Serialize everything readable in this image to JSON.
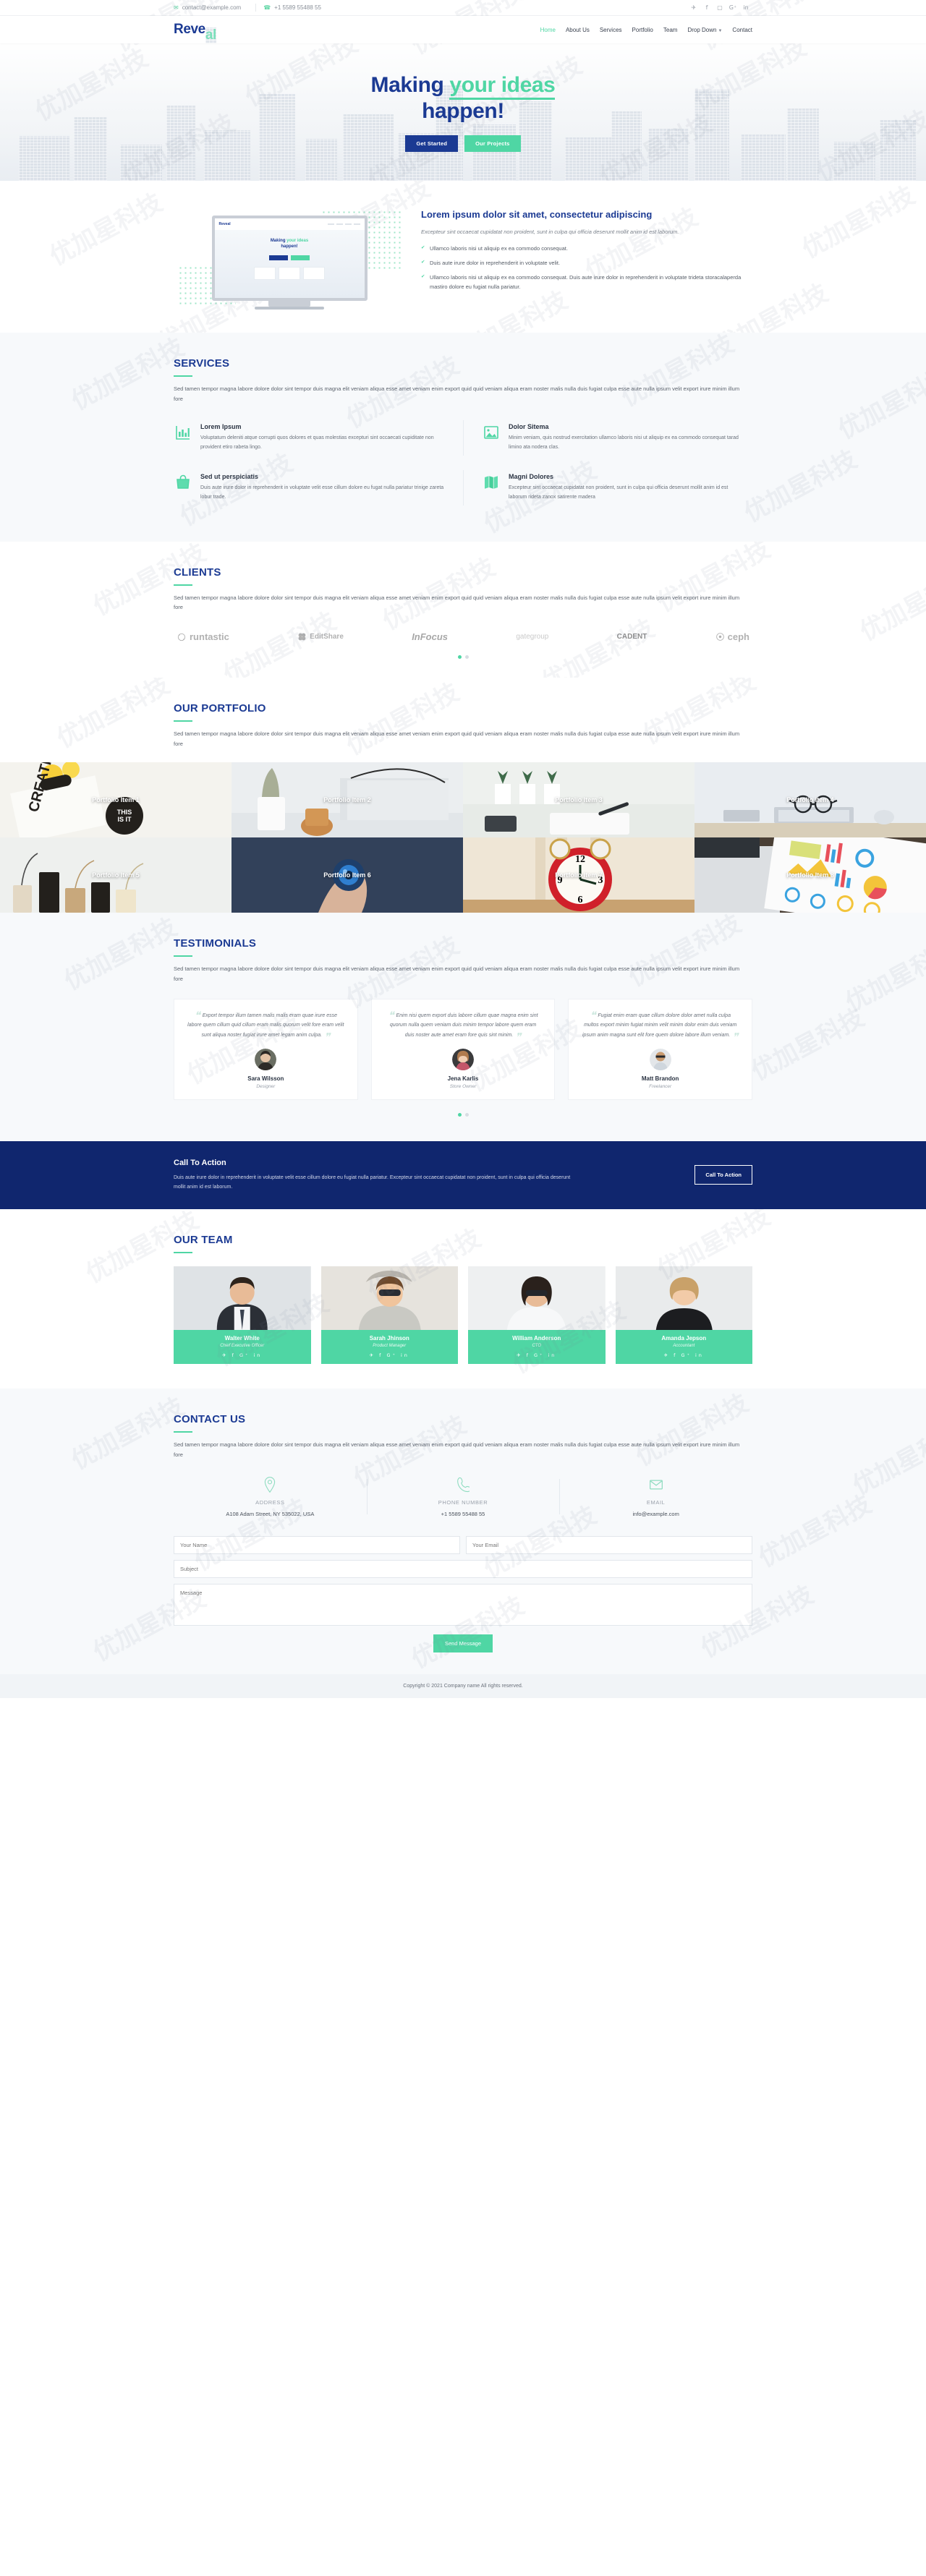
{
  "topbar": {
    "email": "contact@example.com",
    "phone": "+1 5589 55488 55",
    "email_icon": "envelope-icon",
    "phone_icon": "phone-icon",
    "social": [
      {
        "name": "twitter",
        "glyph": "✈"
      },
      {
        "name": "facebook",
        "glyph": "f"
      },
      {
        "name": "instagram",
        "glyph": "▢"
      },
      {
        "name": "google-plus",
        "glyph": "G⁺"
      },
      {
        "name": "linkedin",
        "glyph": "in"
      }
    ]
  },
  "nav": {
    "logo_a": "Reve",
    "logo_b": "al",
    "items": [
      {
        "label": "Home",
        "active": true
      },
      {
        "label": "About Us",
        "active": false
      },
      {
        "label": "Services",
        "active": false
      },
      {
        "label": "Portfolio",
        "active": false
      },
      {
        "label": "Team",
        "active": false
      },
      {
        "label": "Drop Down",
        "active": false,
        "caret": true
      },
      {
        "label": "Contact",
        "active": false
      }
    ]
  },
  "hero": {
    "title_part1": "Making ",
    "title_highlight": "your ideas",
    "title_part2": "happen!",
    "btn_primary": "Get Started",
    "btn_secondary": "Our Projects"
  },
  "about": {
    "heading": "Lorem ipsum dolor sit amet, consectetur adipiscing",
    "lead": "Excepteur sint occaecat cupidatat non proident, sunt in culpa qui officia deserunt mollit anim id est laborum.",
    "bullets": [
      "Ullamco laboris nisi ut aliquip ex ea commodo consequat.",
      "Duis aute irure dolor in reprehenderit in voluptate velit.",
      "Ullamco laboris nisi ut aliquip ex ea commodo consequat. Duis aute irure dolor in reprehenderit in voluptate trideta storacalaperda mastiro dolore eu fugiat nulla pariatur."
    ],
    "monitor": {
      "mini_logo": "Reveal",
      "mini_title_1": "Making ",
      "mini_title_hl": "your ideas",
      "mini_title_2": "happen!"
    }
  },
  "services": {
    "title": "SERVICES",
    "desc": "Sed tamen tempor magna labore dolore dolor sint tempor duis magna elit veniam aliqua esse amet veniam enim export quid quid veniam aliqua eram noster malis nulla duis fugiat culpa esse aute nulla ipsum velit export irure minim illum fore",
    "items": [
      {
        "icon": "bar-chart-icon",
        "title": "Lorem Ipsum",
        "text": "Voluptatum deleniti atque corrupti quos dolores et quas molestias excepturi sint occaecati cupiditate non provident etiro rabeta lingo."
      },
      {
        "icon": "image-icon",
        "title": "Dolor Sitema",
        "text": "Minim veniam, quis nostrud exercitation ullamco laboris nisi ut aliquip ex ea commodo consequat tarad limino ata nodera clas."
      },
      {
        "icon": "bag-icon",
        "title": "Sed ut perspiciatis",
        "text": "Duis aute irure dolor in reprehenderit in voluptate velit esse cillum dolore eu fugat nulla pariatur trinige zareta lobur trade."
      },
      {
        "icon": "map-icon",
        "title": "Magni Dolores",
        "text": "Excepteur sint occaecat cupidatat non proident, sunt in culpa qui officia deserunt mollit anim id est laborum rideta zanox satirente madera"
      }
    ]
  },
  "clients": {
    "title": "CLIENTS",
    "desc": "Sed tamen tempor magna labore dolore dolor sint tempor duis magna elit veniam aliqua esse amet veniam enim export quid quid veniam aliqua eram noster malis nulla duis fugiat culpa esse aute nulla ipsum velit export irure minim illum fore",
    "logos": [
      "runtastic",
      "EditShare",
      "InFocus",
      "gategroup",
      "CADENT",
      "ceph"
    ],
    "carousel_dots": 2,
    "carousel_active": 0
  },
  "portfolio": {
    "title": "OUR PORTFOLIO",
    "desc": "Sed tamen tempor magna labore dolore dolor sint tempor duis magna elit veniam aliqua esse amet veniam enim export quid quid veniam aliqua eram noster malis nulla duis fugiat culpa esse aute nulla ipsum velit export irure minim illum fore",
    "items": [
      {
        "label": "Portfolio Item 1"
      },
      {
        "label": "Portfolio Item 2"
      },
      {
        "label": "Portfolio Item 3"
      },
      {
        "label": "Portfolio Item 4"
      },
      {
        "label": "Portfolio Item 5"
      },
      {
        "label": "Portfolio Item 6"
      },
      {
        "label": "Portfolio Item 7"
      },
      {
        "label": "Portfolio Item 8"
      }
    ]
  },
  "testimonials": {
    "title": "TESTIMONIALS",
    "desc": "Sed tamen tempor magna labore dolore dolor sint tempor duis magna elit veniam aliqua esse amet veniam enim export quid quid veniam aliqua eram noster malis nulla duis fugiat culpa esse aute nulla ipsum velit export irure minim illum fore",
    "items": [
      {
        "quote": "Export tempor illum tamen malis malis eram quae irure esse labore quem cillum quid cillum eram malis quorum velit fore eram velit sunt aliqua noster fugiat irure amet legam anim culpa.",
        "name": "Sara Wilsson",
        "role": "Designer"
      },
      {
        "quote": "Enim nisi quem export duis labore cillum quae magna enim sint quorum nulla quem veniam duis minim tempor labore quem eram duis noster aute amet eram fore quis sint minim.",
        "name": "Jena Karlis",
        "role": "Store Owner"
      },
      {
        "quote": "Fugiat enim eram quae cillum dolore dolor amet nulla culpa multos export minim fugiat minim velit minim dolor enim duis veniam ipsum anim magna sunt elit fore quem dolore labore illum veniam.",
        "name": "Matt Brandon",
        "role": "Freelancer"
      }
    ],
    "carousel_dots": 2,
    "carousel_active": 0
  },
  "cta": {
    "heading": "Call To Action",
    "text": "Duis aute irure dolor in reprehenderit in voluptate velit esse cillum dolore eu fugiat nulla pariatur. Excepteur sint occaecat cupidatat non proident, sunt in culpa qui officia deserunt mollit anim id est laborum.",
    "button": "Call To Action"
  },
  "team": {
    "title": "OUR TEAM",
    "members": [
      {
        "name": "Walter White",
        "role": "Chief Executive Officer"
      },
      {
        "name": "Sarah Jhinson",
        "role": "Product Manager"
      },
      {
        "name": "William Anderson",
        "role": "CTO"
      },
      {
        "name": "Amanda Jepson",
        "role": "Accountant"
      }
    ],
    "social_glyphs": "✈ f G⁺ in"
  },
  "contact": {
    "title": "CONTACT US",
    "desc": "Sed tamen tempor magna labore dolore dolor sint tempor duis magna elit veniam aliqua esse amet veniam enim export quid quid veniam aliqua eram noster malis nulla duis fugiat culpa esse aute nulla ipsum velit export irure minim illum fore",
    "info": [
      {
        "icon": "location-pin-icon",
        "label": "ADDRESS",
        "value": "A108 Adam Street, NY 535022, USA"
      },
      {
        "icon": "phone-icon",
        "label": "PHONE NUMBER",
        "value": "+1 5589 55488 55"
      },
      {
        "icon": "envelope-icon",
        "label": "EMAIL",
        "value": "info@example.com"
      }
    ],
    "form": {
      "name_placeholder": "Your Name",
      "email_placeholder": "Your Email",
      "subject_placeholder": "Subject",
      "message_placeholder": "Message",
      "submit": "Send Message"
    }
  },
  "footer": {
    "copyright": "Copyright © 2021 Company name All rights reserved."
  },
  "watermark_text": "优加星科技",
  "colors": {
    "brand_blue": "#1b3a93",
    "brand_green": "#4fd6a4",
    "cta_bg": "#10266e"
  }
}
